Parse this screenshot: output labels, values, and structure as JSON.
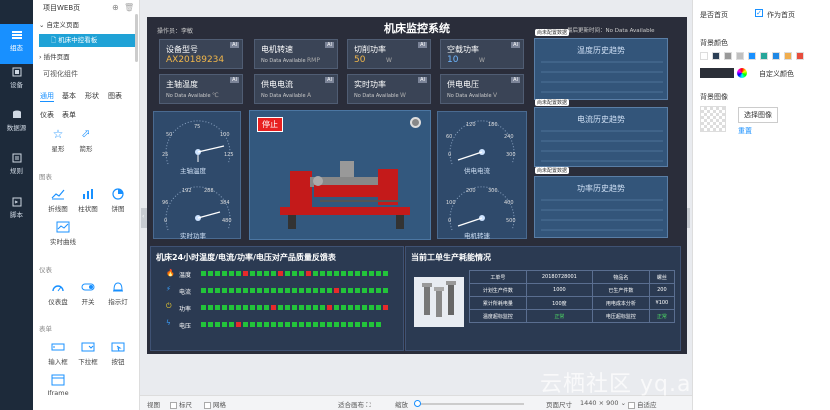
{
  "rail": [
    {
      "label": "组态",
      "active": true
    },
    {
      "label": "设备"
    },
    {
      "label": "数据源"
    },
    {
      "label": "规则"
    },
    {
      "label": "脚本"
    }
  ],
  "panel": {
    "project": "项目WEB页",
    "tree": [
      "自定义页面",
      "机床中控看板",
      "插件页面"
    ],
    "visual": "可视化组件",
    "tabs": [
      "通用",
      "基本",
      "形状",
      "图表",
      "仪表",
      "表单"
    ],
    "shapes": [
      "星形",
      "箭形"
    ],
    "groups": {
      "chart": "图表",
      "meter": "仪表",
      "form": "表单"
    },
    "charts": [
      "折线图",
      "柱状图",
      "饼图",
      "实时曲线"
    ],
    "meters": [
      "仪表盘",
      "开关",
      "指示灯"
    ],
    "forms": [
      "输入框",
      "下拉框",
      "按钮",
      "Iframe"
    ]
  },
  "dash": {
    "title": "机床监控系统",
    "operator": "操作员：李敏",
    "latest": "最后更新时间：No Data Available",
    "cards_top": [
      {
        "label": "设备型号",
        "value": "AX20189234",
        "unit": ""
      },
      {
        "label": "电机转速",
        "nodata": "No Data Available",
        "unit": "RMP"
      },
      {
        "label": "切削功率",
        "value": "50",
        "unit": "W"
      },
      {
        "label": "空载功率",
        "value": "10",
        "unit": "W"
      }
    ],
    "cards_bottom": [
      {
        "label": "主轴温度",
        "nodata": "No Data Available",
        "unit": "℃"
      },
      {
        "label": "供电电流",
        "nodata": "No Data Available",
        "unit": "A"
      },
      {
        "label": "实时功率",
        "nodata": "No Data Available",
        "unit": "W"
      },
      {
        "label": "供电电压",
        "nodata": "No Data Available",
        "unit": "V"
      }
    ],
    "ai": "AI",
    "stop": "停止",
    "gauges": [
      "主轴温度",
      "实时功率",
      "供电电流",
      "电机转速"
    ],
    "gauge_ticks": [
      [
        "25",
        "50",
        "75",
        "100",
        "125"
      ],
      [
        "0",
        "96",
        "192",
        "288",
        "384",
        "480"
      ],
      [
        "0",
        "60",
        "120",
        "180",
        "240",
        "300"
      ],
      [
        "0",
        "100",
        "200",
        "300",
        "400",
        "500"
      ]
    ],
    "trends": [
      "温度历史趋势",
      "电流历史趋势",
      "功率历史趋势"
    ],
    "trend_tag": "尚未配置数据",
    "bars_title": "机床24小时温度/电流/功率/电压对产品质量反馈表",
    "bar_rows": [
      {
        "label": "温度",
        "cells": "ggggggrggggrgggrggggggggggg"
      },
      {
        "label": "电流",
        "cells": "gggggggggggggggggggrggggggg"
      },
      {
        "label": "功率",
        "cells": "ggggggggggrgggggggrgggggggr"
      },
      {
        "label": "电压",
        "cells": "gggggrgggggggggggggggggggg"
      }
    ],
    "work_title": "当前工单生产耗能情况",
    "table": [
      [
        "工单号",
        "20180728001",
        "物品名",
        "螺丝"
      ],
      [
        "计划生产件数",
        "1000",
        "已生产件数",
        "200"
      ],
      [
        "累计所耗电量",
        "100度",
        "用电成本分析",
        "¥100"
      ],
      [
        "温度超标监控",
        "正常",
        "电压超标监控",
        "正常"
      ]
    ]
  },
  "props": {
    "home": "是否首页",
    "as_home": "作为首页",
    "bg_color": "背景颜色",
    "custom_color": "自定义颜色",
    "bg_image": "背景图像",
    "choose": "选择图像",
    "reset": "重置",
    "swatches": [
      "#ffffff",
      "#2b3f55",
      "#999999",
      "#c0c0c0",
      "#1890ff",
      "#26a69a",
      "#1e88e5",
      "#f0ad4e",
      "#e74c3c"
    ]
  },
  "bottombar": {
    "view": "视图",
    "ruler": "标尺",
    "grid": "网格",
    "fit": "适合画布",
    "zoom": "缩放",
    "size": "页面尺寸",
    "size_value": "1440 × 900",
    "auto": "自适应"
  },
  "watermark": "云栖社区 yq.aliyun.com"
}
